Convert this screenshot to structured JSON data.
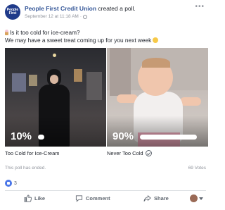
{
  "post": {
    "page_name": "People First Credit Union",
    "action_text": "created a poll.",
    "avatar_text": "People First",
    "timestamp": "September 12 at 11:18 AM",
    "text_line1": "Is it too cold for ice-cream?",
    "text_line2": "We may have a sweet treat coming up for you next week"
  },
  "poll": {
    "options": [
      {
        "label": "Too Cold for Ice-Cream",
        "percent_text": "10%",
        "share": 0.1
      },
      {
        "label": "Never Too Cold",
        "percent_text": "90%",
        "share": 0.9,
        "selected": true
      }
    ],
    "status": "This poll has ended.",
    "votes": "69 Votes"
  },
  "reactions": {
    "count": "3"
  },
  "actions": {
    "like": "Like",
    "comment": "Comment",
    "share": "Share"
  },
  "icons": {
    "globe": "globe-icon",
    "like": "thumbs-up-icon",
    "comment": "speech-bubble-icon",
    "share": "share-arrow-icon",
    "check": "check-circle-icon"
  },
  "colors": {
    "link": "#365899",
    "like_badge": "#4a76e8",
    "muted": "#90949c"
  }
}
